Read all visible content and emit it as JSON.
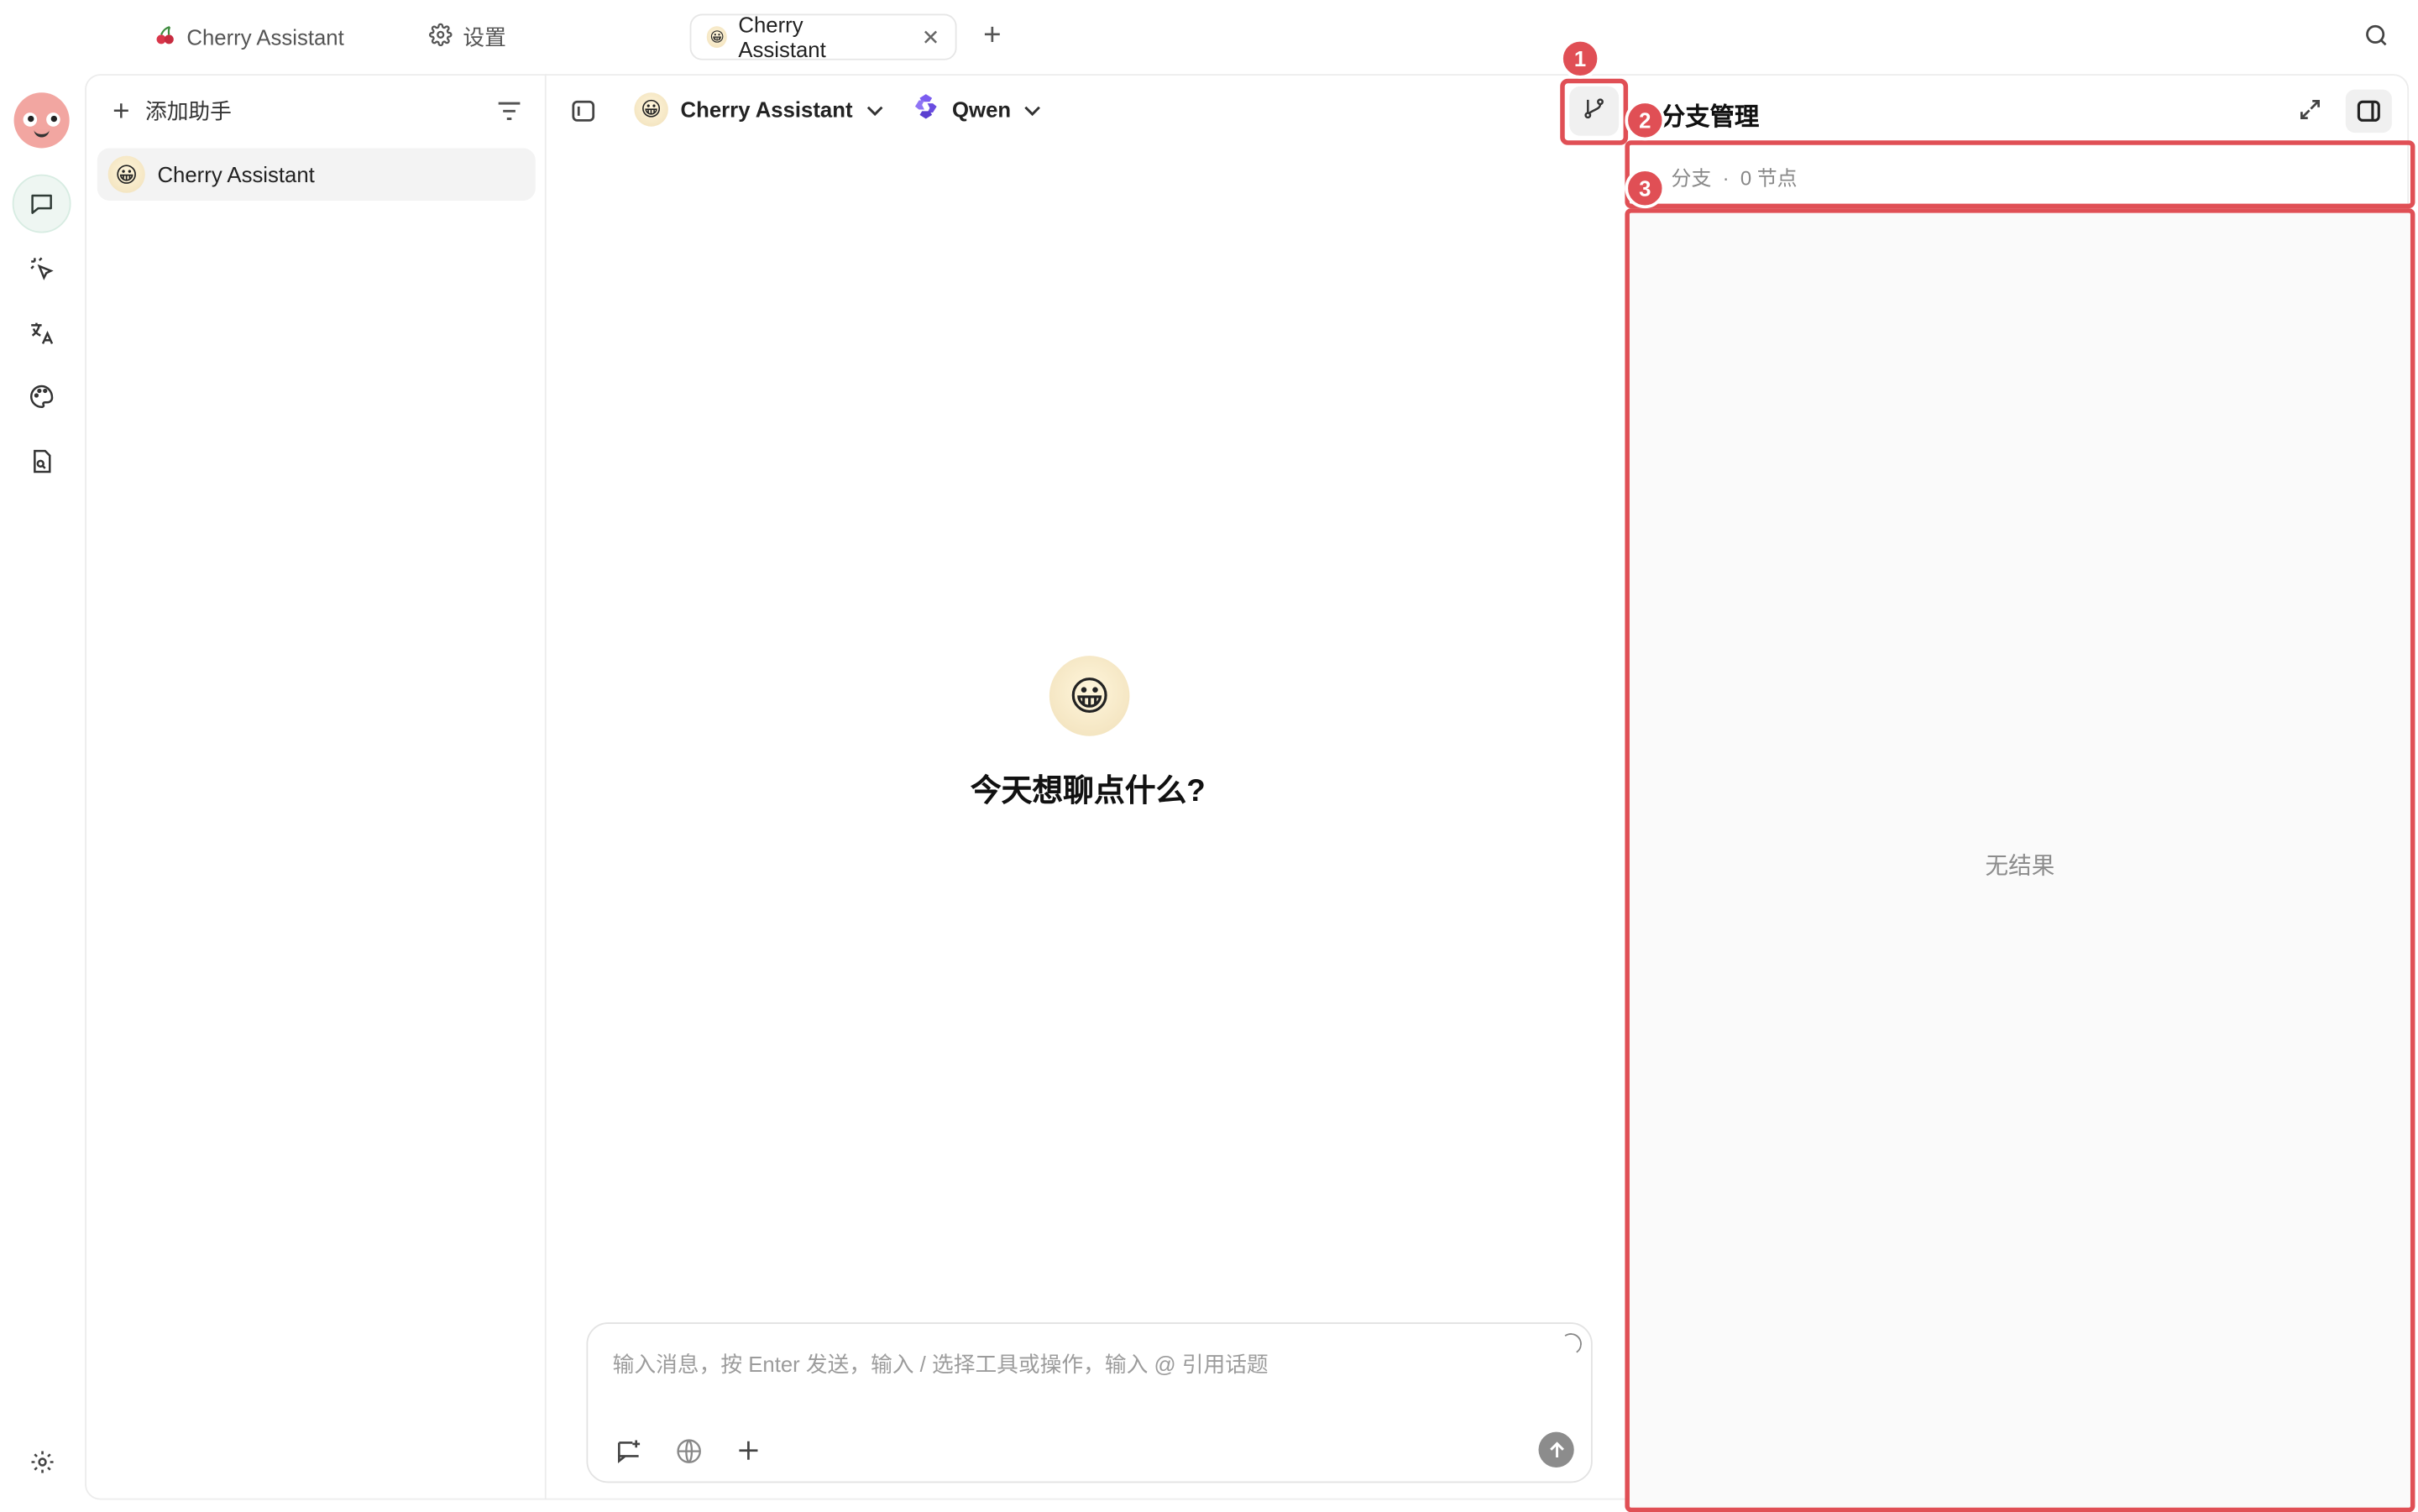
{
  "tabs": [
    {
      "label": "Cherry Assistant",
      "icon": "cherry-icon"
    },
    {
      "label": "设置",
      "icon": "gear-icon"
    },
    {
      "label": "Cherry Assistant",
      "icon": "smiley-icon",
      "active": true
    }
  ],
  "sidebar": {
    "add_assistant": "添加助手",
    "assistant_item": "Cherry Assistant"
  },
  "chat": {
    "assistant_name": "Cherry Assistant",
    "model_name": "Qwen",
    "welcome": "今天想聊点什么?",
    "input_placeholder": "输入消息，按 Enter 发送，输入 / 选择工具或操作，输入 @ 引用话题"
  },
  "branch_panel": {
    "title": "分支管理",
    "stats": "分支  ·  0 节点",
    "empty": "无结果"
  },
  "annotations": [
    "1",
    "2",
    "3"
  ],
  "colors": {
    "annotation": "#e04f55",
    "accent": "#3aa57a"
  }
}
